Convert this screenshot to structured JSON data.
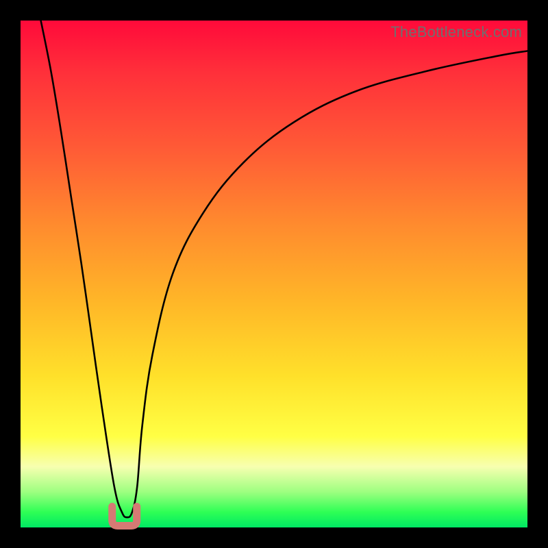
{
  "watermark": "TheBottleneck.com",
  "chart_data": {
    "type": "line",
    "title": "",
    "xlabel": "",
    "ylabel": "",
    "xlim": [
      0,
      100
    ],
    "ylim": [
      0,
      100
    ],
    "grid": false,
    "legend": false,
    "series": [
      {
        "name": "bottleneck-curve",
        "color": "#000000",
        "x": [
          4,
          6,
          8,
          10,
          12,
          14,
          16,
          18.5,
          20,
          21,
          22,
          23,
          24,
          26,
          30,
          36,
          44,
          54,
          66,
          80,
          94,
          100
        ],
        "y": [
          100,
          90,
          78,
          65,
          52,
          38,
          24,
          8,
          3,
          2,
          3,
          8,
          20,
          34,
          50,
          62,
          72,
          80,
          86,
          90,
          93,
          94
        ]
      }
    ],
    "annotations": [
      {
        "name": "valley-marker",
        "shape": "u",
        "x": 20.5,
        "y": 2.5,
        "color": "#d57a74"
      }
    ]
  }
}
